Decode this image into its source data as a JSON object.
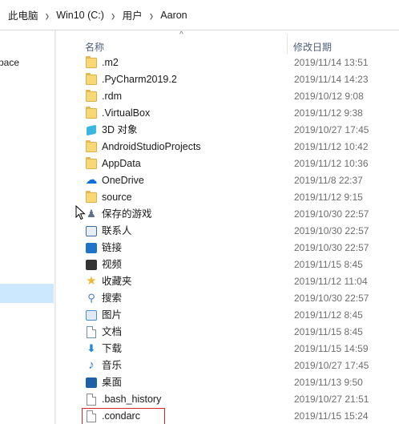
{
  "breadcrumb": {
    "items": [
      "此电脑",
      "Win10 (C:)",
      "用户",
      "Aaron"
    ],
    "separator": "›"
  },
  "nav": {
    "partial_label": "pace"
  },
  "columns": {
    "name": "名称",
    "date_modified": "修改日期"
  },
  "files": [
    {
      "name": ".m2",
      "date": "2019/11/14 13:51",
      "icon": "folder-icon",
      "color": "#f8d775"
    },
    {
      "name": ".PyCharm2019.2",
      "date": "2019/11/14 14:23",
      "icon": "folder-icon",
      "color": "#f8d775"
    },
    {
      "name": ".rdm",
      "date": "2019/10/12 9:08",
      "icon": "folder-icon",
      "color": "#f8d775"
    },
    {
      "name": ".VirtualBox",
      "date": "2019/11/12 9:38",
      "icon": "folder-icon",
      "color": "#f8d775"
    },
    {
      "name": "3D 对象",
      "date": "2019/10/27 17:45",
      "icon": "3d-objects-icon",
      "color": "#3ab7e0"
    },
    {
      "name": "AndroidStudioProjects",
      "date": "2019/11/12 10:42",
      "icon": "folder-icon",
      "color": "#f8d775"
    },
    {
      "name": "AppData",
      "date": "2019/11/12 10:36",
      "icon": "folder-icon",
      "color": "#f8d775"
    },
    {
      "name": "OneDrive",
      "date": "2019/11/8 22:37",
      "icon": "onedrive-icon",
      "color": "#0a6fd6"
    },
    {
      "name": "source",
      "date": "2019/11/12 9:15",
      "icon": "folder-icon",
      "color": "#f8d775"
    },
    {
      "name": "保存的游戏",
      "date": "2019/10/30 22:57",
      "icon": "saved-games-icon",
      "color": "#5a6f8a"
    },
    {
      "name": "联系人",
      "date": "2019/10/30 22:57",
      "icon": "contacts-icon",
      "color": "#3b6ea8"
    },
    {
      "name": "链接",
      "date": "2019/10/30 22:57",
      "icon": "links-icon",
      "color": "#1f74c9"
    },
    {
      "name": "视频",
      "date": "2019/11/15 8:45",
      "icon": "videos-icon",
      "color": "#333333"
    },
    {
      "name": "收藏夹",
      "date": "2019/11/12 11:04",
      "icon": "favorites-icon",
      "color": "#f2b632"
    },
    {
      "name": "搜索",
      "date": "2019/10/30 22:57",
      "icon": "search-icon",
      "color": "#4a7fb8"
    },
    {
      "name": "图片",
      "date": "2019/11/12 8:45",
      "icon": "pictures-icon",
      "color": "#4a90c8"
    },
    {
      "name": "文档",
      "date": "2019/11/15 8:45",
      "icon": "documents-icon",
      "color": "#6d8fb0"
    },
    {
      "name": "下载",
      "date": "2019/11/15 14:59",
      "icon": "downloads-icon",
      "color": "#1f8ad8"
    },
    {
      "name": "音乐",
      "date": "2019/10/27 17:45",
      "icon": "music-icon",
      "color": "#1f74c9"
    },
    {
      "name": "桌面",
      "date": "2019/11/13 9:50",
      "icon": "desktop-icon",
      "color": "#1f5fa8"
    },
    {
      "name": ".bash_history",
      "date": "2019/10/27 21:51",
      "icon": "file-icon",
      "color": "#ffffff"
    },
    {
      "name": ".condarc",
      "date": "2019/11/15 15:24",
      "icon": "file-icon",
      "color": "#ffffff",
      "highlighted": true
    }
  ],
  "colors": {
    "highlight_border": "#d9262a",
    "nav_selected": "#cce8ff",
    "header_text": "#4c607a"
  }
}
